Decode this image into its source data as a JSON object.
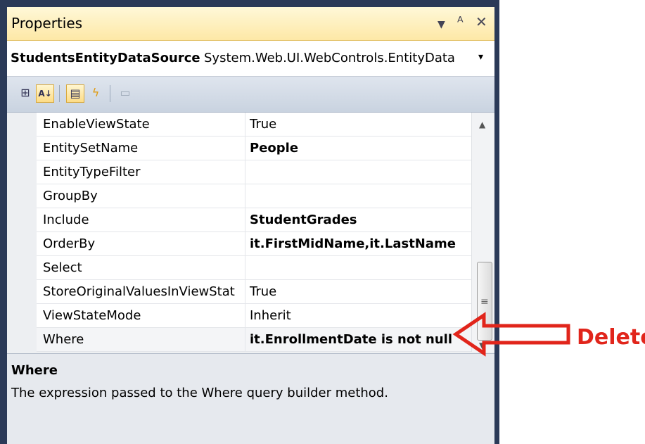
{
  "window": {
    "title": "Properties",
    "pin_glyph": "ᵖ",
    "close_glyph": "✕",
    "dropdown_glyph": "▼"
  },
  "selector": {
    "object_name": "StudentsEntityDataSource",
    "object_type": "System.Web.UI.WebControls.EntityData",
    "dropdown_glyph": "▾"
  },
  "toolbar": {
    "categorized_glyph": "⊞",
    "alphabetical_glyph": "A↓",
    "properties_glyph": "▤",
    "events_glyph": "ϟ",
    "property_pages_glyph": "▭"
  },
  "properties": [
    {
      "name": "EnableViewState",
      "value": "True",
      "bold": false
    },
    {
      "name": "EntitySetName",
      "value": "People",
      "bold": true
    },
    {
      "name": "EntityTypeFilter",
      "value": "",
      "bold": false
    },
    {
      "name": "GroupBy",
      "value": "",
      "bold": false
    },
    {
      "name": "Include",
      "value": "StudentGrades",
      "bold": true
    },
    {
      "name": "OrderBy",
      "value": "it.FirstMidName,it.LastName",
      "bold": true
    },
    {
      "name": "Select",
      "value": "",
      "bold": false
    },
    {
      "name": "StoreOriginalValuesInViewStat",
      "value": "True",
      "bold": false
    },
    {
      "name": "ViewStateMode",
      "value": "Inherit",
      "bold": false
    },
    {
      "name": "Where",
      "value": "it.EnrollmentDate is not null",
      "bold": true
    }
  ],
  "scrollbar": {
    "up_glyph": "▲",
    "down_glyph": "▼",
    "grip_glyph": "≡"
  },
  "description": {
    "title": "Where",
    "text": "The expression passed to the Where query builder method."
  },
  "annotation": {
    "label": "Delete",
    "color": "#e1251b"
  }
}
